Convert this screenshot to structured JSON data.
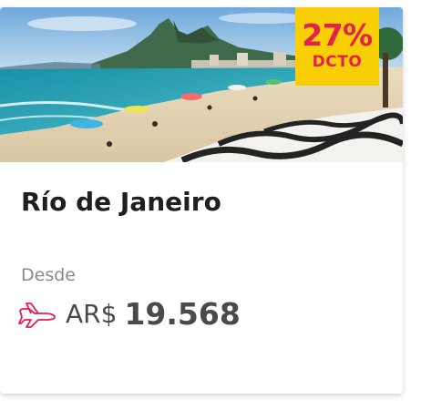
{
  "card": {
    "destination": "Río de Janeiro",
    "discount": {
      "percent": "27%",
      "label": "DCTO",
      "bg_color": "#f8cf04",
      "text_color": "#e3214f"
    },
    "price": {
      "from_label": "Desde",
      "currency": "AR$",
      "amount": "19.568",
      "icon": "airplane-icon",
      "icon_color": "#e3214f"
    },
    "image": "ipanema-beach-photo"
  }
}
